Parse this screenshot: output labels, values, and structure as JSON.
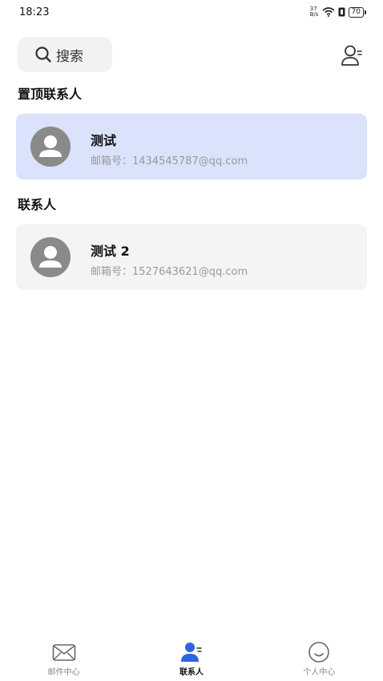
{
  "status_bar": {
    "time": "18:23",
    "net_speed_top": "37",
    "net_speed_bottom": "B/s",
    "battery": "70"
  },
  "header": {
    "search_label": "搜索",
    "search_icon": "search-icon",
    "add_contact_icon": "add-contact-icon"
  },
  "pinned_section": {
    "title": "置顶联系人",
    "contacts": [
      {
        "name": "测试",
        "email": "邮箱号：1434545787@qq.com"
      }
    ]
  },
  "contacts_section": {
    "title": "联系人",
    "contacts": [
      {
        "name": "测试 2",
        "email": "邮箱号：1527643621@qq.com"
      }
    ]
  },
  "tab_bar": {
    "tabs": [
      {
        "label": "邮件中心",
        "icon": "mail-icon",
        "active": false
      },
      {
        "label": "联系人",
        "icon": "contacts-icon",
        "active": true
      },
      {
        "label": "个人中心",
        "icon": "profile-icon",
        "active": false
      }
    ]
  },
  "colors": {
    "accent": "#2e63e6",
    "pinned_card_bg": "#dae2fc",
    "card_bg": "#f4f4f4",
    "avatar_gray": "#8a8a8a"
  }
}
